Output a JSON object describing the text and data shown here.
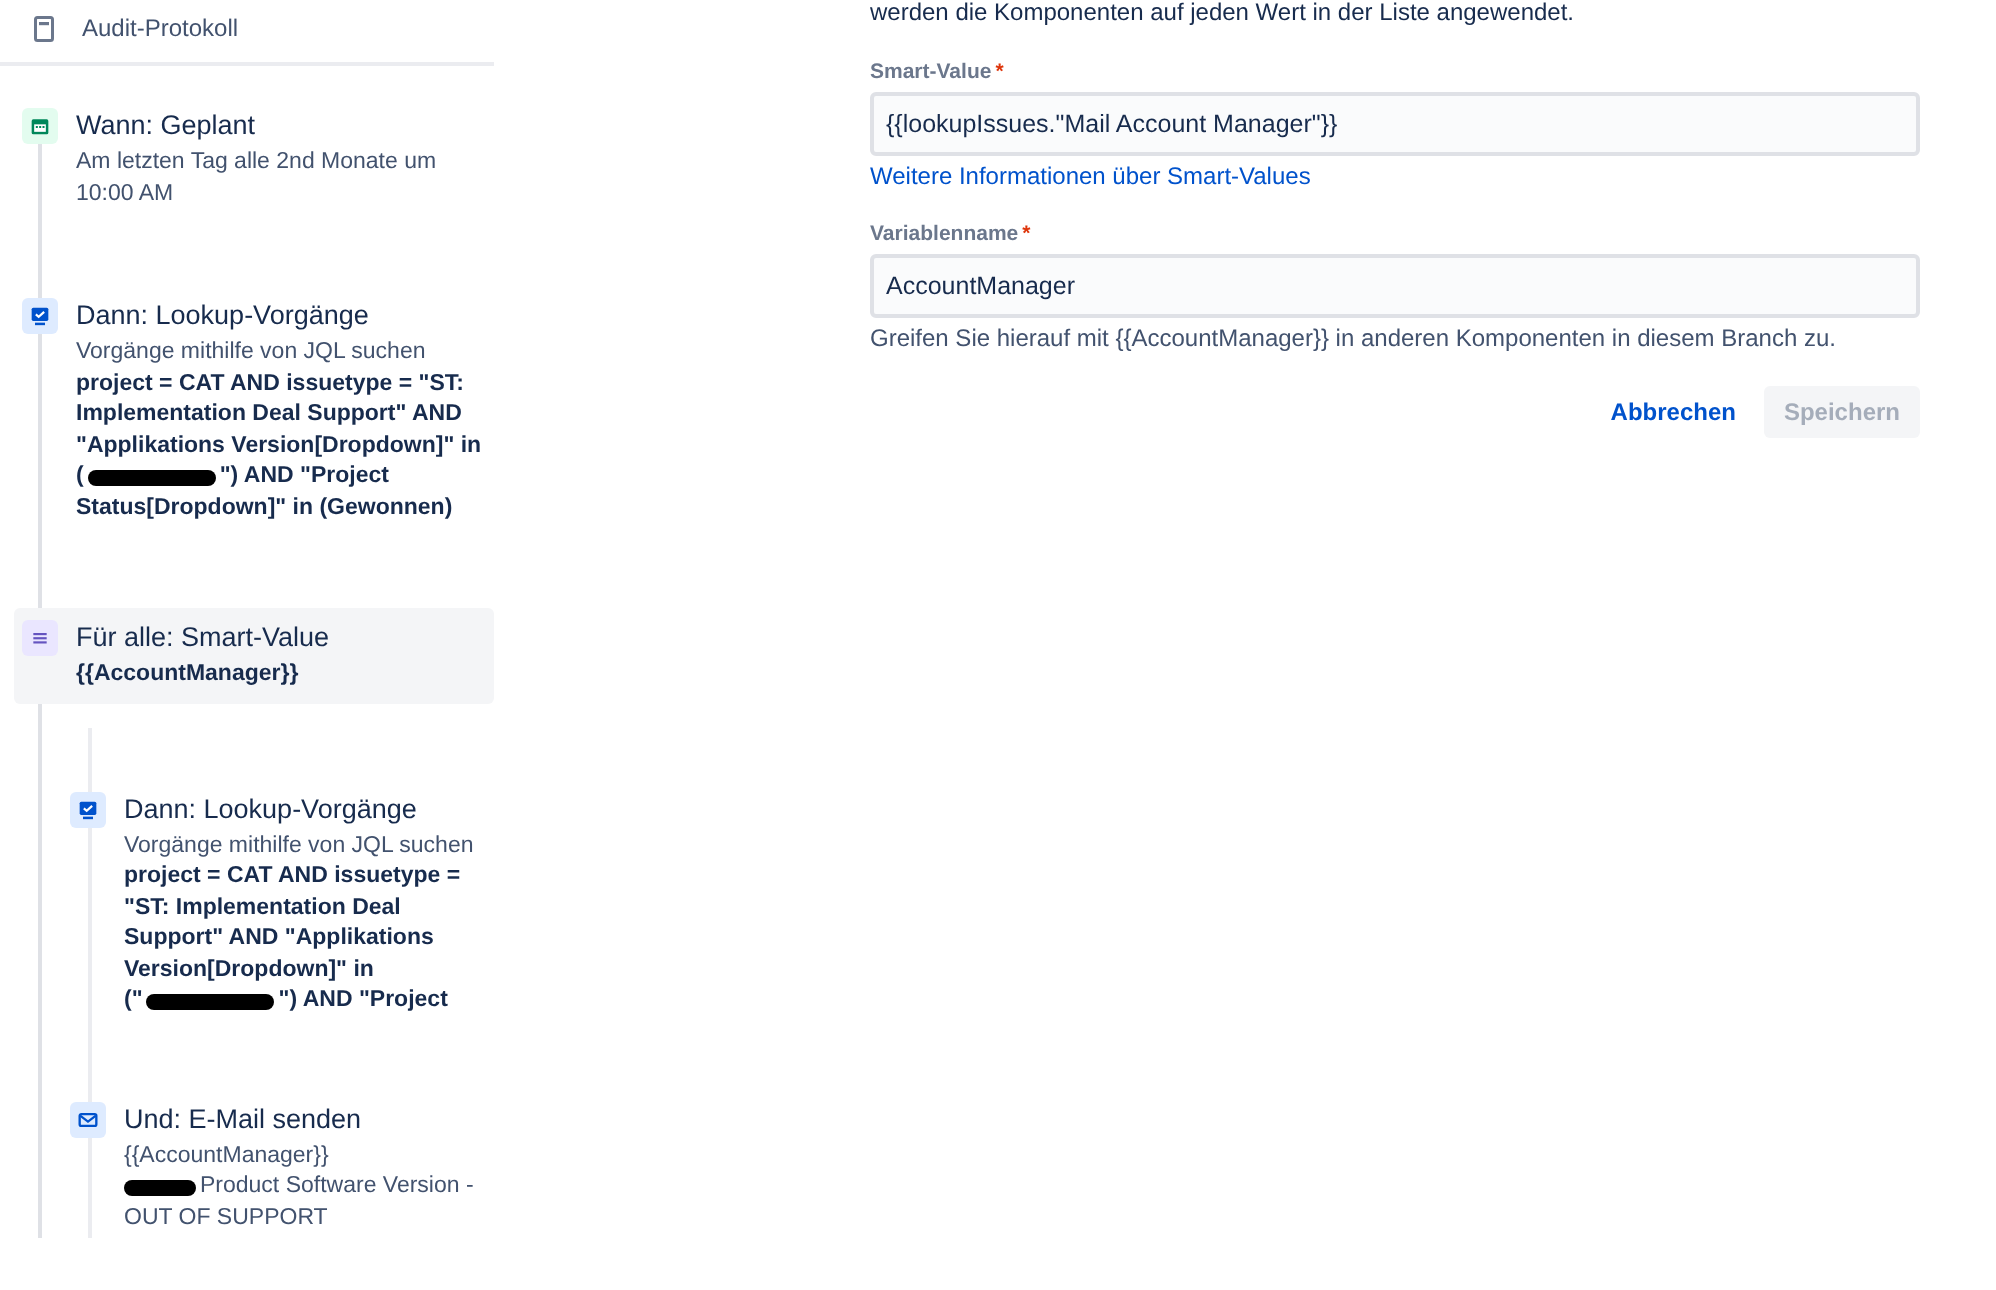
{
  "sidebar": {
    "header": {
      "label": "Audit-Protokoll"
    },
    "steps": [
      {
        "kind": "trigger",
        "title": "Wann: Geplant",
        "selected": false,
        "lines": [
          {
            "kind": "note",
            "segments": [
              {
                "text": "Am letzten Tag alle 2nd Monate um 10:00 AM"
              }
            ]
          }
        ]
      },
      {
        "kind": "action",
        "title": "Dann: Lookup-Vorgänge",
        "selected": false,
        "lines": [
          {
            "kind": "note",
            "segments": [
              {
                "text": "Vorgänge mithilfe von JQL suchen"
              }
            ]
          },
          {
            "kind": "query",
            "segments": [
              {
                "text": "project = CAT AND issuetype = \"ST: Implementation Deal Support\" AND \"Applikations Version[Dropdown]\" in"
              }
            ]
          },
          {
            "kind": "query",
            "segments": [
              {
                "text": "("
              },
              {
                "kind": "redaction"
              },
              {
                "text": "\") AND \"Project"
              }
            ]
          },
          {
            "kind": "query",
            "segments": [
              {
                "text": "Status[Dropdown]\" in (Gewonnen)"
              }
            ]
          }
        ]
      },
      {
        "kind": "branch",
        "title": "Für alle: Smart-Value",
        "selected": true,
        "lines": [
          {
            "kind": "query",
            "segments": [
              {
                "text": "{{AccountManager}}"
              }
            ]
          }
        ],
        "children": [
          {
            "kind": "action",
            "title": "Dann: Lookup-Vorgänge",
            "lines": [
              {
                "kind": "note",
                "segments": [
                  {
                    "text": "Vorgänge mithilfe von JQL suchen"
                  }
                ]
              },
              {
                "kind": "query",
                "segments": [
                  {
                    "text": "project = CAT AND issuetype = \"ST: Implementation Deal Support\" AND \"Applikations Version[Dropdown]\" in"
                  }
                ]
              },
              {
                "kind": "query",
                "segments": [
                  {
                    "text": "(\""
                  },
                  {
                    "kind": "redaction"
                  },
                  {
                    "text": "\") AND \"Project"
                  }
                ]
              }
            ]
          },
          {
            "kind": "email",
            "title": "Und: E-Mail senden",
            "lines": [
              {
                "kind": "note",
                "segments": [
                  {
                    "text": "{{AccountManager}}"
                  }
                ]
              },
              {
                "kind": "note",
                "segments": [
                  {
                    "kind": "redaction"
                  },
                  {
                    "text": "Product Software Version -"
                  }
                ]
              },
              {
                "kind": "note",
                "segments": [
                  {
                    "text": "OUT OF SUPPORT"
                  }
                ]
              }
            ]
          }
        ]
      }
    ]
  },
  "panel": {
    "intro": "werden die Komponenten auf jeden Wert in der Liste angewendet.",
    "fields": [
      {
        "label": "Smart-Value",
        "required_mark": "*",
        "value": "{{lookupIssues.\"Mail Account Manager\"}}",
        "link": "Weitere Informationen über Smart-Values"
      },
      {
        "label": "Variablenname",
        "required_mark": "*",
        "value": "AccountManager",
        "help": "Greifen Sie hierauf mit {{AccountManager}} in anderen Komponenten in diesem Branch zu."
      }
    ],
    "buttons": [
      {
        "label": "Abbrechen",
        "kind": "link",
        "disabled": false
      },
      {
        "label": "Speichern",
        "kind": "primary",
        "disabled": true
      }
    ]
  }
}
